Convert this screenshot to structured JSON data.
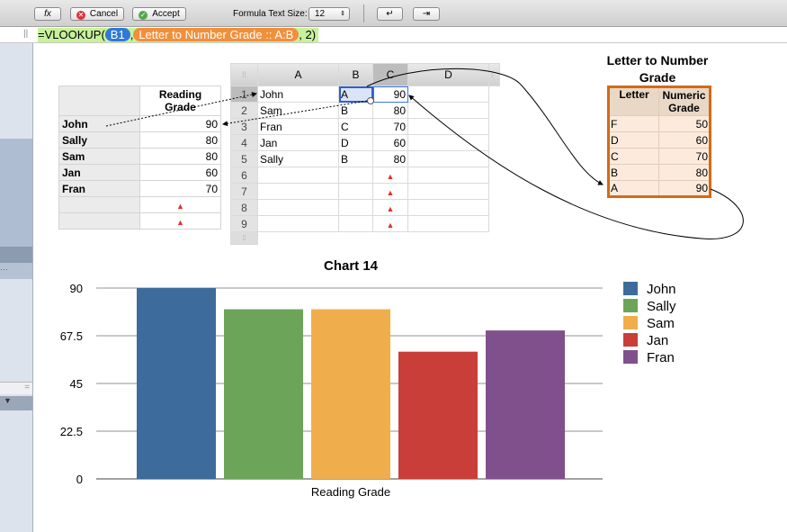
{
  "toolbar": {
    "fx_label": "fx",
    "cancel_label": "Cancel",
    "accept_label": "Accept",
    "text_size_label": "Formula Text Size:",
    "text_size_value": "12",
    "return_label": "↵",
    "tab_label": "⇥"
  },
  "formula": {
    "prefix": "=VLOOKUP(",
    "arg1": "B1",
    "sep": ",",
    "arg2": "Letter to Number Grade :: A:B",
    "suffix": ", 2)"
  },
  "reading_table": {
    "header": "Reading Grade",
    "rows": [
      {
        "name": "John",
        "value": "90"
      },
      {
        "name": "Sally",
        "value": "80"
      },
      {
        "name": "Sam",
        "value": "80"
      },
      {
        "name": "Jan",
        "value": "60"
      },
      {
        "name": "Fran",
        "value": "70"
      }
    ]
  },
  "sheet": {
    "columns": [
      "A",
      "B",
      "C",
      "D"
    ],
    "row_numbers": [
      "1",
      "2",
      "3",
      "4",
      "5",
      "6",
      "7",
      "8",
      "9"
    ],
    "rows": [
      [
        "John",
        "A",
        "90"
      ],
      [
        "Sam",
        "B",
        "80"
      ],
      [
        "Fran",
        "C",
        "70"
      ],
      [
        "Jan",
        "D",
        "60"
      ],
      [
        "Sally",
        "B",
        "80"
      ]
    ]
  },
  "lookup_table": {
    "title": "Letter to Number Grade",
    "headers": [
      "Letter",
      "Numeric Grade"
    ],
    "rows": [
      [
        "F",
        "50"
      ],
      [
        "D",
        "60"
      ],
      [
        "C",
        "70"
      ],
      [
        "B",
        "80"
      ],
      [
        "A",
        "90"
      ]
    ]
  },
  "chart_data": {
    "type": "bar",
    "title": "Chart 14",
    "categories": [
      "Reading Grade"
    ],
    "xlabel": "Reading Grade",
    "ylabel": "",
    "ylim": [
      0,
      90
    ],
    "yticks": [
      "0",
      "22.5",
      "45",
      "67.5",
      "90"
    ],
    "grid": true,
    "legend": "right",
    "series": [
      {
        "name": "John",
        "values": [
          90
        ],
        "color": "#3d6b9b"
      },
      {
        "name": "Sally",
        "values": [
          80
        ],
        "color": "#6ca55a"
      },
      {
        "name": "Sam",
        "values": [
          80
        ],
        "color": "#efae4b"
      },
      {
        "name": "Jan",
        "values": [
          60
        ],
        "color": "#c93e38"
      },
      {
        "name": "Fran",
        "values": [
          70
        ],
        "color": "#80508c"
      }
    ]
  }
}
